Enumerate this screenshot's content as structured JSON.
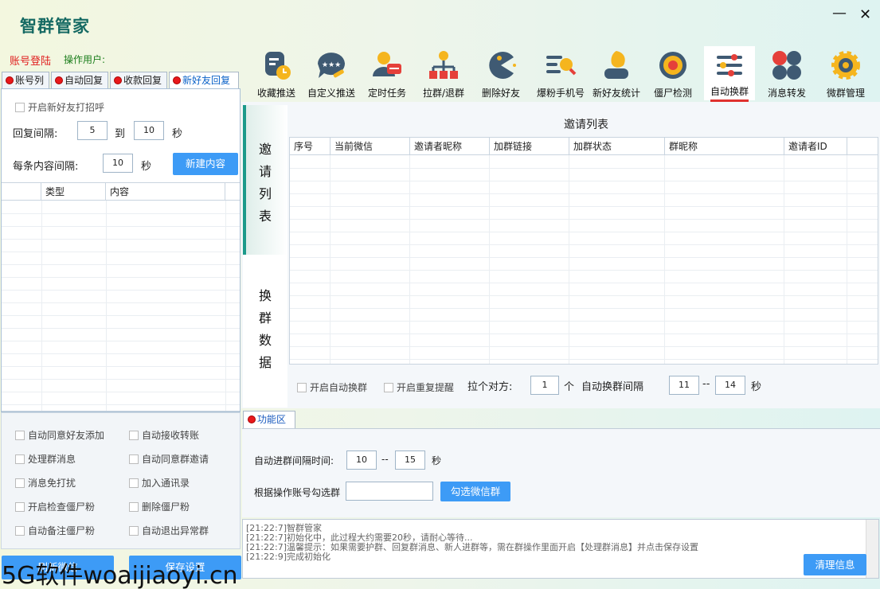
{
  "app": {
    "title": "智群管家",
    "minimize": "—",
    "close": "✕",
    "login_label": "账号登陆",
    "operator_label": "操作用户:"
  },
  "toolbar": [
    {
      "label": "收藏推送",
      "icon": "doc-clock-icon"
    },
    {
      "label": "自定义推送",
      "icon": "chat-stars-icon"
    },
    {
      "label": "定时任务",
      "icon": "user-chat-icon"
    },
    {
      "label": "拉群/退群",
      "icon": "org-chart-icon"
    },
    {
      "label": "删除好友",
      "icon": "pacman-icon"
    },
    {
      "label": "爆粉手机号",
      "icon": "list-search-icon"
    },
    {
      "label": "新好友统计",
      "icon": "leaf-user-icon"
    },
    {
      "label": "僵尸检测",
      "icon": "target-icon"
    },
    {
      "label": "自动换群",
      "icon": "sliders-icon"
    },
    {
      "label": "消息转发",
      "icon": "dots-grid-icon"
    },
    {
      "label": "微群管理",
      "icon": "gear-icon"
    }
  ],
  "left_tabs": [
    "账号列",
    "自动回复",
    "收款回复",
    "新好友回复"
  ],
  "greeting": {
    "enable_label": "开启新好友打招呼",
    "reply_interval_label": "回复间隔:",
    "from": "5",
    "to_label": "到",
    "to": "10",
    "sec": "秒",
    "item_interval_label": "每条内容间隔:",
    "item_interval": "10",
    "item_sec": "秒",
    "new_button": "新建内容",
    "columns": [
      "类型",
      "内容"
    ]
  },
  "options": [
    [
      "自动同意好友添加",
      "自动接收转账"
    ],
    [
      "处理群消息",
      "自动同意群邀请"
    ],
    [
      "消息免打扰",
      "加入通讯录"
    ],
    [
      "开启检查僵尸粉",
      "删除僵尸粉"
    ],
    [
      "自动备注僵尸粉",
      "自动退出异常群"
    ]
  ],
  "bottom_buttons": [
    "刷新微信",
    "保存设置"
  ],
  "side": {
    "invite_label": "邀请列表",
    "swap_label": "换群数据"
  },
  "invite": {
    "title": "邀请列表",
    "columns": [
      "序号",
      "当前微信",
      "邀请者昵称",
      "加群链接",
      "加群状态",
      "群昵称",
      "邀请者ID"
    ],
    "auto_swap_label": "开启自动换群",
    "repeat_remind_label": "开启重复提醒",
    "pull_label": "拉个对方:",
    "pull_value": "1",
    "pull_unit": "个",
    "swap_interval_label": "自动换群间隔",
    "swap_from": "11",
    "dash": "--",
    "swap_to": "14",
    "swap_sec": "秒"
  },
  "func": {
    "tab": "功能区",
    "join_interval_label": "自动进群间隔时间:",
    "join_from": "10",
    "dash": "--",
    "join_to": "15",
    "sec": "秒",
    "select_label": "根据操作账号勾选群",
    "select_value": "",
    "select_button": "勾选微信群"
  },
  "log": {
    "lines": [
      "[21:22:7]智群管家",
      "[21:22:7]初始化中，此过程大约需要20秒，请耐心等待...",
      "[21:22:7]温馨提示：如果需要护群、回复群消息、新人进群等，需在群操作里面开启【处理群消息】并点击保存设置",
      "[21:22:9]完成初始化"
    ],
    "clear_button": "清理信息"
  },
  "watermark": "5G软件woaijiaoyi.cn"
}
